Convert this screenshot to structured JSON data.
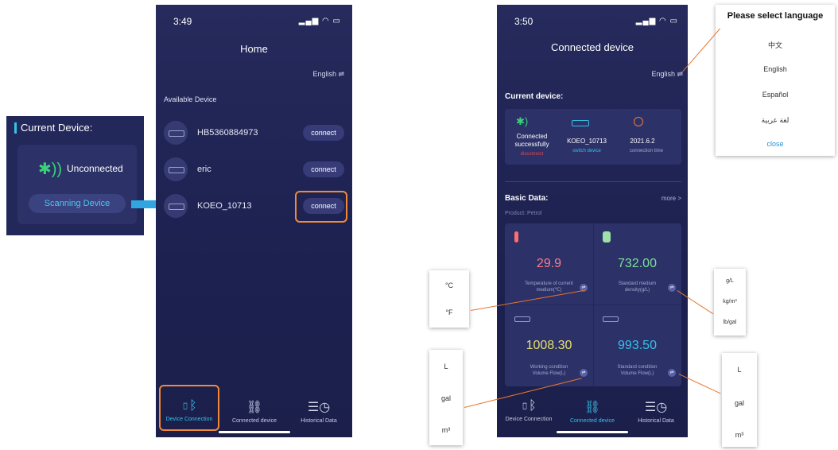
{
  "colors": {
    "phone_bg": "#1d2150",
    "accent_orange": "#f08a3a",
    "accent_cyan": "#36c2e8",
    "temp_red": "#ff7a85",
    "density_green": "#7be09a",
    "flow_yellow": "#e6e06a",
    "flow_cyan": "#36c2e8"
  },
  "left_inset": {
    "title": "Current Device:",
    "bluetooth_icon": "bluetooth-icon",
    "status": "Unconnected",
    "scan_button": "Scanning Device"
  },
  "phone1": {
    "time": "3:49",
    "signal": "signal-wifi-battery-icons",
    "title": "Home",
    "language": "English ⇌",
    "section": "Available Device",
    "devices": [
      {
        "name": "HB5360884973",
        "button": "connect"
      },
      {
        "name": "eric",
        "button": "connect"
      },
      {
        "name": "KOEO_10713",
        "button": "connect"
      }
    ],
    "tabs": [
      {
        "label": "Device Connection",
        "icon": "phone-bluetooth-icon"
      },
      {
        "label": "Connected device",
        "icon": "link-icon"
      },
      {
        "label": "Historical Data",
        "icon": "history-icon"
      }
    ]
  },
  "phone2": {
    "time": "3:50",
    "title": "Connected device",
    "language": "English ⇌",
    "current_device_header": "Current device:",
    "status_line1": "Connected",
    "status_line2": "successfully",
    "disconnect": "disconnect",
    "device_name": "KOEO_10713",
    "switch_device": "switch device",
    "date": "2021.6.2",
    "connection_time": "connection time",
    "basic_data": "Basic Data:",
    "more": "more  >",
    "product": "Product: Petrol",
    "metrics": [
      {
        "value": "29.9",
        "label1": "Temperature of current",
        "label2": "medium(℃)",
        "icon": "thermometer-icon"
      },
      {
        "value": "732.00",
        "label1": "Standard medium",
        "label2": "density(g/L)",
        "icon": "density-icon"
      },
      {
        "value": "1008.30",
        "label1": "Working condition",
        "label2": "Volume Flow(L)",
        "icon": "flowmeter-icon"
      },
      {
        "value": "993.50",
        "label1": "Standard condition",
        "label2": "Volume Flow(L)",
        "icon": "flowmeter-icon"
      }
    ],
    "tabs": [
      {
        "label": "Device Connection",
        "icon": "phone-bluetooth-icon"
      },
      {
        "label": "Connected device",
        "icon": "link-icon"
      },
      {
        "label": "Historical Data",
        "icon": "history-icon"
      }
    ]
  },
  "language_popup": {
    "title": "Please select language",
    "options": [
      "中文",
      "English",
      "Español",
      "لغة عربية"
    ],
    "close": "close"
  },
  "unit_temp": [
    "°C",
    "°F"
  ],
  "unit_density": [
    "g/L",
    "kg/m³",
    "lb/gal"
  ],
  "unit_volume_left": [
    "L",
    "gal",
    "m³"
  ],
  "unit_volume_right": [
    "L",
    "gal",
    "m³"
  ]
}
